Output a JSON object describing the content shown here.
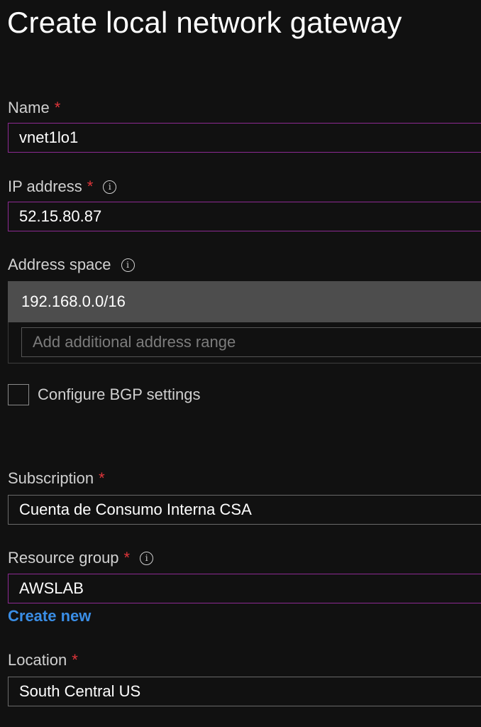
{
  "page": {
    "title": "Create local network gateway"
  },
  "name": {
    "label": "Name",
    "required": "*",
    "value": "vnet1lo1"
  },
  "ip_address": {
    "label": "IP address",
    "required": "*",
    "info": "i",
    "value": "52.15.80.87"
  },
  "address_space": {
    "label": "Address space",
    "info": "i",
    "ranges": [
      "192.168.0.0/16"
    ],
    "add_placeholder": "Add additional address range"
  },
  "bgp": {
    "label": "Configure BGP settings",
    "checked": false
  },
  "subscription": {
    "label": "Subscription",
    "required": "*",
    "value": "Cuenta de Consumo Interna CSA"
  },
  "resource_group": {
    "label": "Resource group",
    "required": "*",
    "info": "i",
    "value": "AWSLAB",
    "create_new_label": "Create new"
  },
  "location": {
    "label": "Location",
    "required": "*",
    "value": "South Central US"
  },
  "colors": {
    "background": "#111111",
    "accent": "#8d2a93",
    "required": "#e0353a",
    "link": "#3a8ee6"
  }
}
